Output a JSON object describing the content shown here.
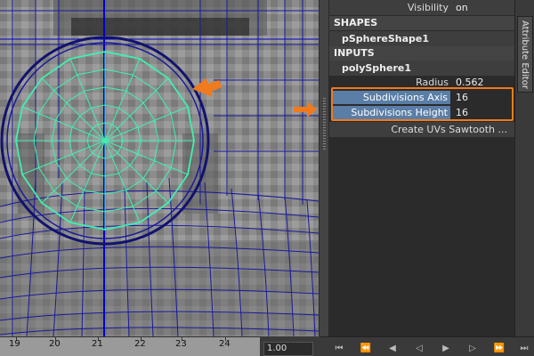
{
  "attribute_editor": {
    "visibility": {
      "label": "Visibility",
      "value": "on"
    },
    "shapes_header": "SHAPES",
    "shape_node": "pSphereShape1",
    "inputs_header": "INPUTS",
    "input_node": "polySphere1",
    "radius": {
      "label": "Radius",
      "value": "0.562"
    },
    "subdivisions_axis": {
      "label": "Subdivisions Axis",
      "value": "16"
    },
    "subdivisions_height": {
      "label": "Subdivisions Height",
      "value": "16"
    },
    "create_uvs": "Create UVs Sawtooth ..."
  },
  "side_tab": {
    "label": "Attribute Editor"
  },
  "timeline": {
    "ticks": [
      "19",
      "20",
      "21",
      "22",
      "23",
      "24"
    ],
    "current_value": "1.00"
  },
  "annotation_color": "#f07a1e",
  "wire_color_selected": "#40f0b0",
  "wire_color": "#1a1a9a"
}
